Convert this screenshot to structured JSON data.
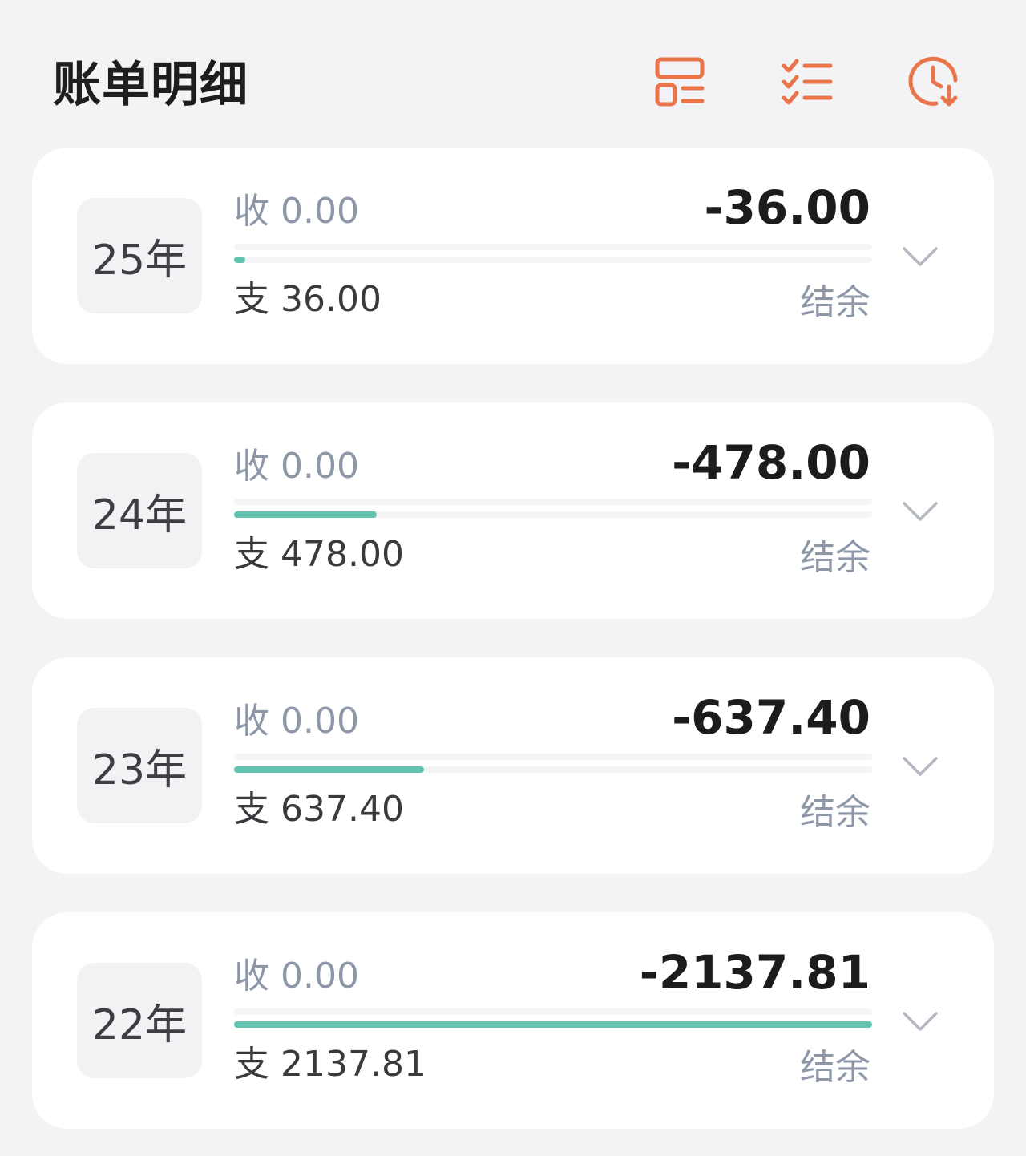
{
  "header": {
    "title": "账单明细",
    "accent_color": "#e8764a",
    "buttons": [
      {
        "icon": "layout-list-icon"
      },
      {
        "icon": "checklist-icon"
      },
      {
        "icon": "clock-download-icon"
      }
    ]
  },
  "progress_color": "#63c2b0",
  "years": [
    {
      "year": "25年",
      "income": "收 0.00",
      "expense": "支 36.00",
      "amount": "-36.00",
      "balance_label": "结余",
      "expense_fraction": 0.017
    },
    {
      "year": "24年",
      "income": "收 0.00",
      "expense": "支 478.00",
      "amount": "-478.00",
      "balance_label": "结余",
      "expense_fraction": 0.224
    },
    {
      "year": "23年",
      "income": "收 0.00",
      "expense": "支 637.40",
      "amount": "-637.40",
      "balance_label": "结余",
      "expense_fraction": 0.298
    },
    {
      "year": "22年",
      "income": "收 0.00",
      "expense": "支 2137.81",
      "amount": "-2137.81",
      "balance_label": "结余",
      "expense_fraction": 1.0
    }
  ]
}
